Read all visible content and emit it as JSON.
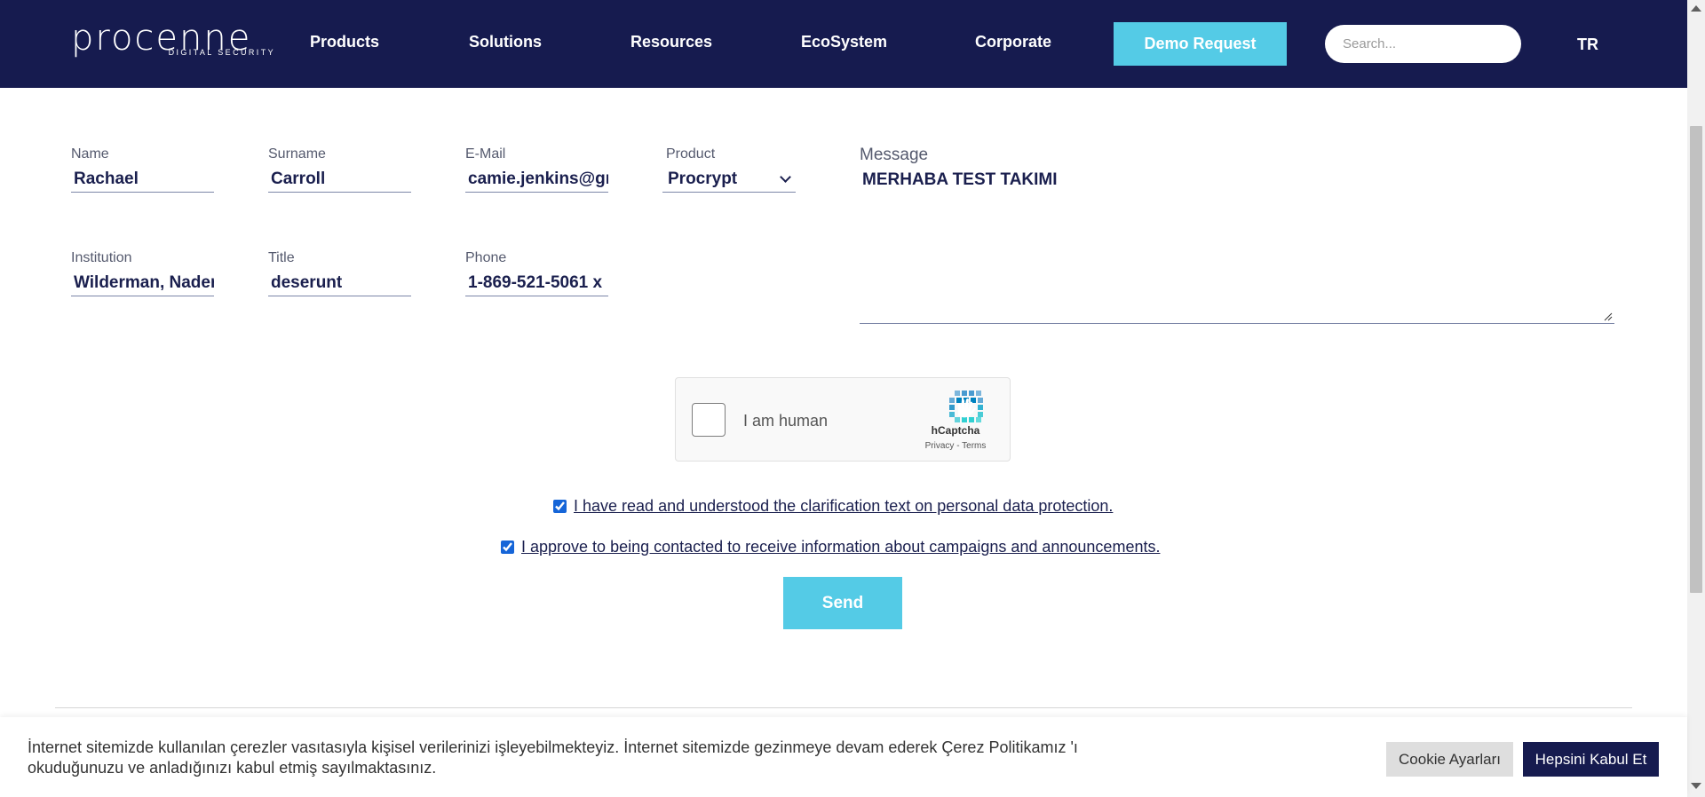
{
  "header": {
    "logo_text": "procenne",
    "logo_tagline": "DIGITAL SECURITY",
    "nav": [
      "Products",
      "Solutions",
      "Resources",
      "EcoSystem",
      "Corporate"
    ],
    "demo_label": "Demo Request",
    "search_placeholder": "Search...",
    "lang_label": "TR"
  },
  "form": {
    "name": {
      "label": "Name",
      "value": "Rachael"
    },
    "surname": {
      "label": "Surname",
      "value": "Carroll"
    },
    "email": {
      "label": "E-Mail",
      "value": "camie.jenkins@gmail.com"
    },
    "product": {
      "label": "Product",
      "value": "Procrypt"
    },
    "institution": {
      "label": "Institution",
      "value": "Wilderman, Nader and Sons"
    },
    "title": {
      "label": "Title",
      "value": "deserunt"
    },
    "phone": {
      "label": "Phone",
      "value": "1-869-521-5061 x"
    },
    "message": {
      "label": "Message",
      "value": "MERHABA TEST TAKIMI"
    }
  },
  "captcha": {
    "text": "I am human",
    "brand": "hCaptcha",
    "links": "Privacy - Terms"
  },
  "consents": [
    {
      "text": "I have read and understood the clarification text on personal data protection.",
      "checked": true
    },
    {
      "text": "I approve to being contacted to receive information about campaigns and announcements.",
      "checked": true
    }
  ],
  "send_label": "Send",
  "cookie": {
    "text": "İnternet sitemizde kullanılan çerezler vasıtasıyla kişisel verilerinizi işleyebilmekteyiz. İnternet sitemizde gezinmeye devam ederek Çerez Politikamız 'ı okuduğunuzu ve anladığınızı kabul etmiş sayılmaktasınız.",
    "settings_label": "Cookie Ayarları",
    "accept_label": "Hepsini Kabul Et"
  },
  "colors": {
    "header_bg": "#161b4f",
    "accent": "#54cbe6"
  }
}
